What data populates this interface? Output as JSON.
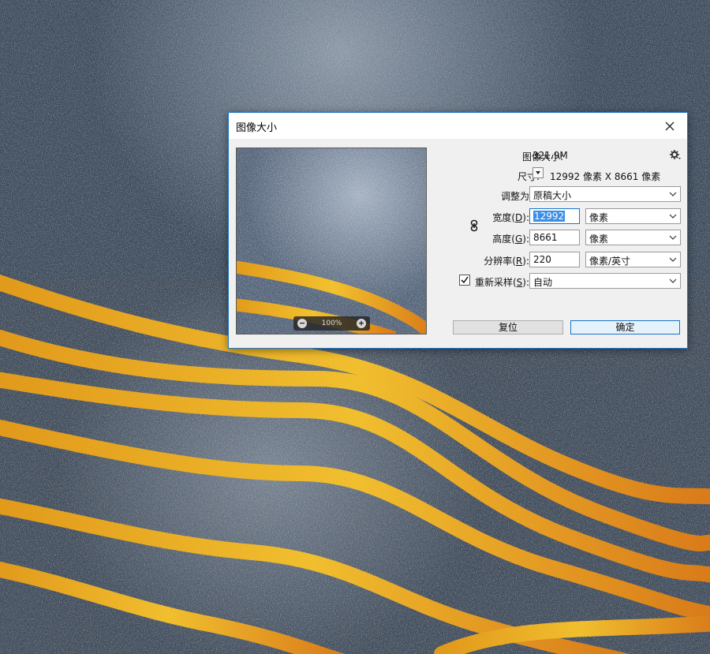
{
  "dialog": {
    "title": "图像大小",
    "image_size_label": "图像大小:",
    "image_size_value": "321.9M",
    "dimensions_label": "尺寸:",
    "dimensions_value": "12992 像素  X  8661 像素",
    "fit_to_label": "调整为",
    "fit_to_label_suffix": "",
    "fit_to_value": "原稿大小",
    "width_label": "宽度",
    "width_hotkey": "D",
    "width_value": "12992",
    "width_unit": "像素",
    "height_label": "高度",
    "height_hotkey": "G",
    "height_value": "8661",
    "height_unit": "像素",
    "resolution_label": "分辨率",
    "resolution_hotkey": "R",
    "resolution_value": "220",
    "resolution_unit": "像素/英寸",
    "resample_label": "重新采样",
    "resample_hotkey": "S",
    "resample_checked": true,
    "resample_value": "自动",
    "zoom_level": "100%",
    "reset_button": "复位",
    "ok_button": "确定"
  },
  "colors": {
    "dialog_border": "#1f78c8",
    "background": "#4a5868",
    "gold": "#f0b020"
  }
}
